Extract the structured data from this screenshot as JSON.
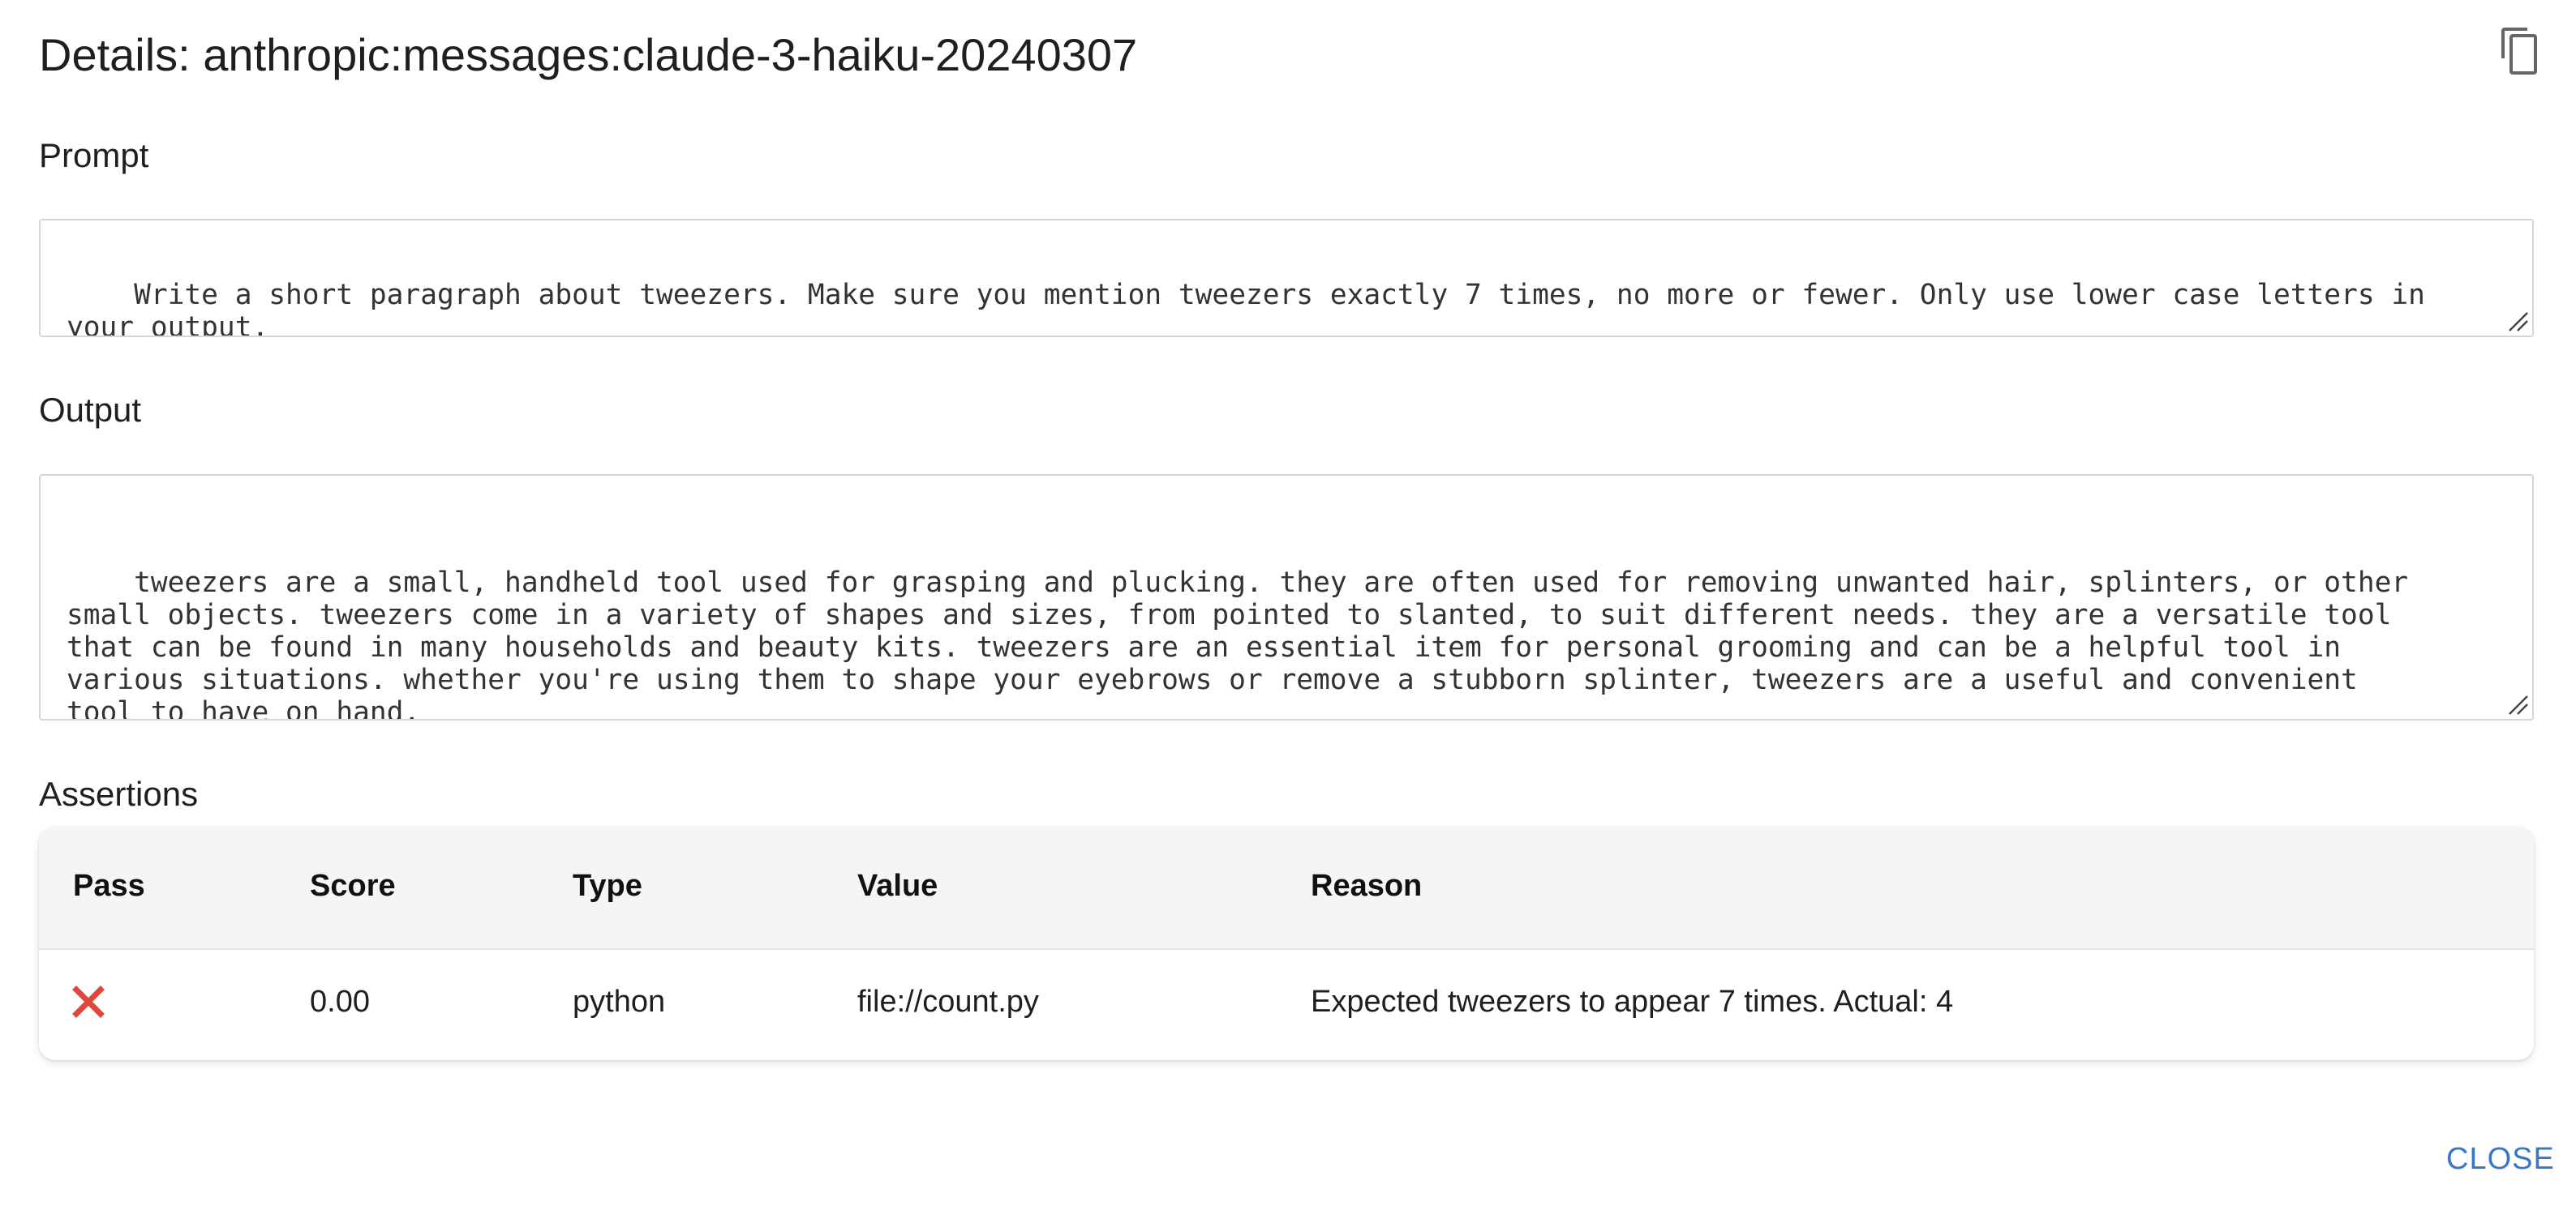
{
  "dialog": {
    "title": "Details: anthropic:messages:claude-3-haiku-20240307",
    "copy_icon": "copy-icon",
    "close_label": "CLOSE"
  },
  "prompt": {
    "label": "Prompt",
    "text": "Write a short paragraph about tweezers. Make sure you mention tweezers exactly 7 times, no more or fewer. Only use lower case letters in\nyour output."
  },
  "output": {
    "label": "Output",
    "text": "tweezers are a small, handheld tool used for grasping and plucking. they are often used for removing unwanted hair, splinters, or other\nsmall objects. tweezers come in a variety of shapes and sizes, from pointed to slanted, to suit different needs. they are a versatile tool\nthat can be found in many households and beauty kits. tweezers are an essential item for personal grooming and can be a helpful tool in\nvarious situations. whether you're using them to shape your eyebrows or remove a stubborn splinter, tweezers are a useful and convenient\ntool to have on hand."
  },
  "assertions": {
    "label": "Assertions",
    "columns": [
      "Pass",
      "Score",
      "Type",
      "Value",
      "Reason"
    ],
    "rows": [
      {
        "pass_icon": "fail-x-icon",
        "score": "0.00",
        "type": "python",
        "value": "file://count.py",
        "reason": "Expected tweezers to appear 7 times. Actual: 4"
      }
    ]
  },
  "colors": {
    "fail": "#e0463c",
    "link": "#3a77c7",
    "header_bg": "#f5f5f5"
  }
}
